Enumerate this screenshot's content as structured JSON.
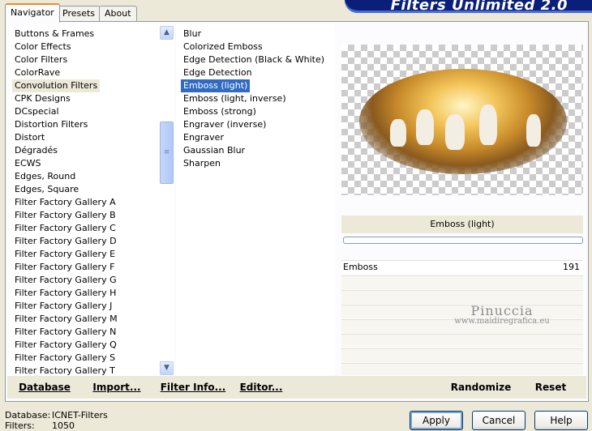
{
  "title": "Filters Unlimited 2.0",
  "tabs": [
    "Navigator",
    "Presets",
    "About"
  ],
  "categories": [
    "Buttons & Frames",
    "Color Effects",
    "Color Filters",
    "ColorRave",
    "Convolution Filters",
    "CPK Designs",
    "DCspecial",
    "Distortion Filters",
    "Distort",
    "Dégradés",
    "ECWS",
    "Edges, Round",
    "Edges, Square",
    "Filter Factory Gallery A",
    "Filter Factory Gallery B",
    "Filter Factory Gallery C",
    "Filter Factory Gallery D",
    "Filter Factory Gallery E",
    "Filter Factory Gallery F",
    "Filter Factory Gallery G",
    "Filter Factory Gallery H",
    "Filter Factory Gallery J",
    "Filter Factory Gallery M",
    "Filter Factory Gallery N",
    "Filter Factory Gallery Q",
    "Filter Factory Gallery S",
    "Filter Factory Gallery T"
  ],
  "selected_category_index": 4,
  "filters": [
    "Blur",
    "Colorized Emboss",
    "Edge Detection (Black & White)",
    "Edge Detection",
    "Emboss (light)",
    "Emboss (light, inverse)",
    "Emboss (strong)",
    "Engraver (inverse)",
    "Engraver",
    "Gaussian Blur",
    "Sharpen"
  ],
  "selected_filter_index": 4,
  "selected_filter_name": "Emboss (light)",
  "parameter": {
    "label": "Emboss",
    "value": "191"
  },
  "watermark": {
    "name": "Pinuccia",
    "url": "www.maidiregrafica.eu"
  },
  "bottom_buttons": {
    "database": "Database",
    "import": "Import...",
    "filter_info": "Filter Info...",
    "editor": "Editor...",
    "randomize": "Randomize",
    "reset": "Reset"
  },
  "status": {
    "database_label": "Database:",
    "database_value": "ICNET-Filters",
    "filters_label": "Filters:",
    "filters_value": "1050"
  },
  "dialog_buttons": {
    "apply": "Apply",
    "cancel": "Cancel",
    "help": "Help"
  },
  "icons": {
    "scroll_up": "chevron-up-icon",
    "scroll_down": "chevron-down-icon"
  },
  "colors": {
    "selection": "#316AC5",
    "banner": "#0A1F7A",
    "dialog_bg": "#ECE9D8"
  }
}
